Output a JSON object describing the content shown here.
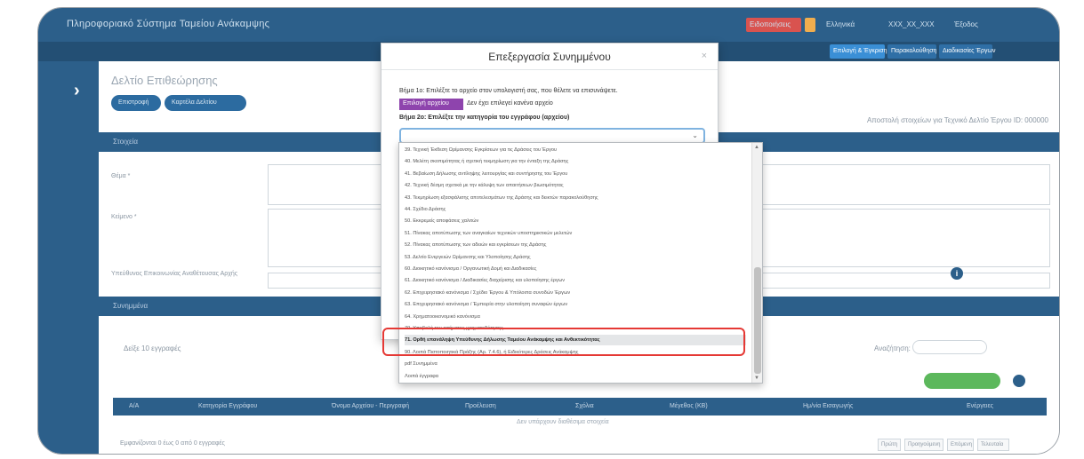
{
  "app": {
    "brand": "Πληροφοριακό Σύστημα Ταμείου Ανάκαμψης",
    "topbar": {
      "alert_label": "Ειδοποιήσεις",
      "language_label": "Ελληνικά",
      "user_label": "ΧΧΧ_ΧΧ_ΧΧΧ",
      "logout_label": "Έξοδος"
    },
    "nav": {
      "n1": "Επιλογή & Έγκριση",
      "n2": "Παρακολούθηση",
      "n3": "Διαδικασίες Έργων"
    }
  },
  "page": {
    "title": "Δελτίο Επιθεώρησης",
    "pill1": "Επιστροφή",
    "pill2": "Καρτέλα Δελτίου",
    "right_text": "Αποστολή στοιχείων για Τεχνικό Δελτίο Έργου  ID: 000000"
  },
  "sections": {
    "s1": "Στοιχεία",
    "s2": "Συνημμένα"
  },
  "form": {
    "f1": "Θέμα *",
    "f2": "Κείμενο *",
    "f3": "Υπεύθυνος Επικοινωνίας Αναθέτουσας Αρχής"
  },
  "list": {
    "show_label": "Δείξε  10  εγγραφές",
    "search_label": "Αναζήτηση:",
    "headers": [
      "Α/Α",
      "Κατηγορία Εγγράφου",
      "Όνομα Αρχείου - Περιγραφή",
      "Προέλευση",
      "Σχόλια",
      "Μέγεθος (ΚΒ)",
      "Ημ/νία Εισαγωγής",
      "Ενέργειες"
    ],
    "no_data": "Δεν υπάρχουν διαθέσιμα στοιχεία",
    "footer": "Εμφανίζονται 0 έως 0 από 0 εγγραφές",
    "pager": {
      "first": "Πρώτη",
      "prev": "Προηγούμενη",
      "next": "Επόμενη",
      "last": "Τελευταία"
    }
  },
  "modal": {
    "title": "Επεξεργασία Συνημμένου",
    "close": "×",
    "step1": "Βήμα 1ο: Επιλέξτε το αρχείο στον υπολογιστή σας, που θέλετε να επισυνάψετε.",
    "choose_label": "Επιλογή αρχείου",
    "no_file": "Δεν έχει επιλεγεί κανένα αρχείο",
    "step2": "Βήμα 2ο: Επιλέξτε την κατηγορία του εγγράφου (αρχείου)",
    "select_chevron": "⌄"
  },
  "dropdown": {
    "items": [
      "39. Τεχνική Έκθεση Ωρίμανσης Εγκρίσεων για τις Δράσεις του Έργου",
      "40. Μελέτη σκοπιμότητας ή σχετική τεκμηρίωση για την ένταξη της Δράσης",
      "41. Βεβαίωση Δήλωσης αντίληψης λειτουργίας και συντήρησης του Έργου",
      "42. Τεχνική δέσμη σχετικά με την κάλυψη των απαιτήσεων βιωσιμότητας",
      "43. Τεκμηρίωση εξασφάλισης αποτελεσμάτων της Δράσης και δεικτών παρακολούθησης",
      "44. Σχέδιο Δράσης",
      "50. Εκκρεμείς αποφάσεις χαλιτών",
      "51. Πίνακας αποτύπωσης των αναγκαίων τεχνικών υποστηρικτικών μελετών",
      "52. Πίνακας αποτύπωσης των αδειών και εγκρίσεων της Δράσης",
      "53. Δελτίο Ενεργειών Ωρίμανσης και Υλοποίησης Δράσης",
      "60. Διοικητικό κανόνισμα / Οργανωτική Δομή και Διαδικασίες",
      "61. Διοικητικό κανόνισμα / Διαδικασίες διαχείρισης και υλοποίησης έργων",
      "62. Επιχειρησιακό κανόνισμα / Σχέδιο Έργου & Υπόλοιπα συνοδών Έργων",
      "63. Επιχειρησιακό κανόνισμα / Έμπειρία στην υλοποίηση συναφών έργων",
      "64. Χρηματοοικονομικό κανόνισμα",
      "70. Υποβολή του αιτήματος χρηματοδότησης",
      "71. Ορθή επανάληψη Υπεύθυνης Δήλωσης Ταμείου Ανάκαμψης και Ανθεκτικότητας",
      "90. Λοιπά Πιστοποιητικά Πράξης (Αρ. 7.4.6), ή Ειδικότερες Δράσεις Ανάκαμψης",
      "pdf Συνημμένα",
      "Λοιπά έγγραφα"
    ],
    "highlighted_index": 16,
    "up": "▲",
    "down": "▼"
  },
  "colors": {
    "primary": "#2c5f8a",
    "accent": "#8e44ad",
    "highlight_border": "#e53935",
    "success": "#5cb85c"
  }
}
